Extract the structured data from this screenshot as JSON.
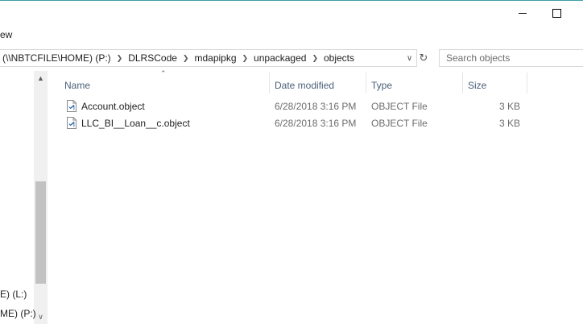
{
  "ribbon": {
    "view_label": "ew"
  },
  "address_bar": {
    "crumbs": [
      "(\\\\NBTCFILE\\HOME) (P:)",
      "DLRSCode",
      "mdapipkg",
      "unpackaged",
      "objects"
    ]
  },
  "search": {
    "placeholder": "Search objects"
  },
  "nav": {
    "items": [
      {
        "label": "E) (L:)"
      },
      {
        "label": "ME) (P:)"
      }
    ]
  },
  "columns": {
    "name": "Name",
    "date_modified": "Date modified",
    "type": "Type",
    "size": "Size"
  },
  "files": [
    {
      "name": "Account.object",
      "date_modified": "6/28/2018 3:16 PM",
      "type": "OBJECT File",
      "size": "3 KB"
    },
    {
      "name": "LLC_BI__Loan__c.object",
      "date_modified": "6/28/2018 3:16 PM",
      "type": "OBJECT File",
      "size": "3 KB"
    }
  ],
  "colors": {
    "accent_line": "#3a9ea8",
    "header_text": "#4c607a",
    "file_icon": "#2b6cb0"
  }
}
